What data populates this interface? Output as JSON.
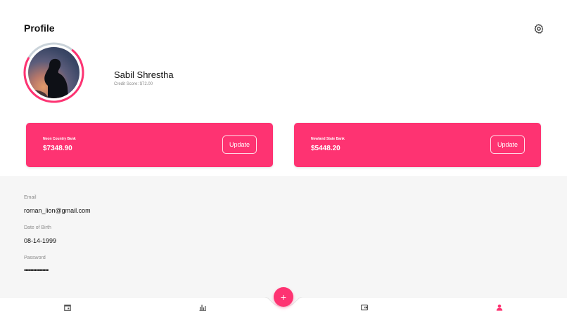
{
  "header": {
    "title": "Profile",
    "settings_icon": "gear-icon"
  },
  "profile": {
    "name": "Sabil Shrestha",
    "credit_score": "Credit Score: $72.00",
    "credit_ring_fraction": 0.72
  },
  "accounts": [
    {
      "bank": "Neon Country Bank",
      "balance": "$7348.90",
      "button": "Update"
    },
    {
      "bank": "Newland State Bank",
      "balance": "$5448.20",
      "button": "Update"
    }
  ],
  "details": {
    "email_label": "Email",
    "email": "roman_lion@gmail.com",
    "dob_label": "Date of Birth",
    "dob": "08-14-1999",
    "password_label": "Password",
    "password": "••••••••••••••••"
  },
  "bottom_nav": {
    "items": [
      "calendar-icon",
      "bar-chart-icon",
      "add-icon",
      "wallet-icon",
      "person-icon"
    ],
    "active": "person-icon",
    "fab_label": "+"
  },
  "colors": {
    "accent": "#fe3372",
    "ring_track": "#c9d2d9",
    "info_background": "#f6f6f6"
  }
}
